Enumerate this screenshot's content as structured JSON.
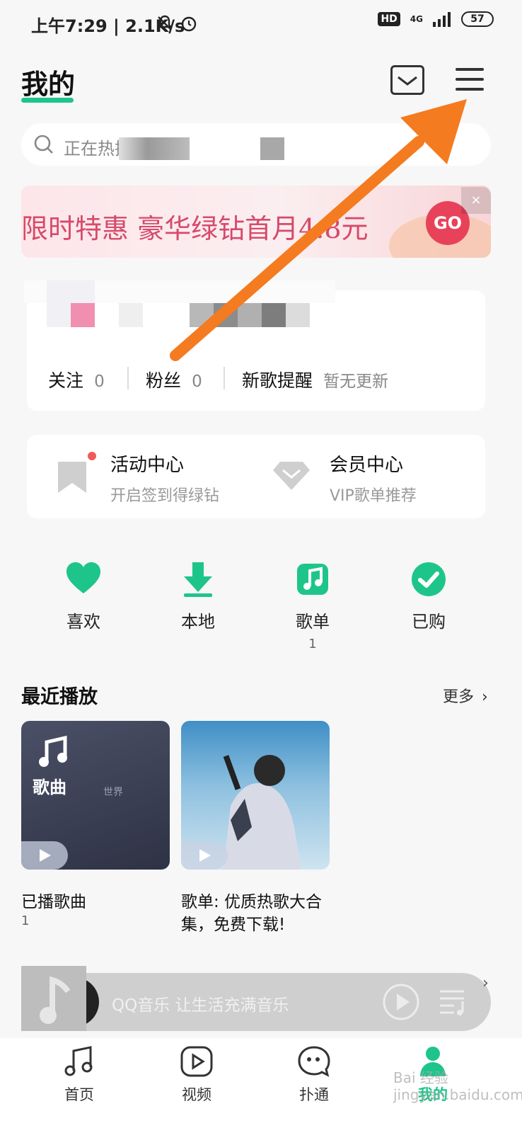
{
  "status_bar": {
    "text": "上午7:29 | 2.1K/s",
    "hd": "HD",
    "network": "4G",
    "battery": "57"
  },
  "header": {
    "title": "我的"
  },
  "search": {
    "placeholder": "正在热搜"
  },
  "promo": {
    "text": "限时特惠 豪华绿钻首月4.8元",
    "go_label": "GO",
    "close_label": "×"
  },
  "profile": {
    "stats": [
      {
        "label": "关注",
        "value": "0"
      },
      {
        "label": "粉丝",
        "value": "0"
      }
    ],
    "new_songs": {
      "label": "新歌提醒",
      "value": "暂无更新"
    }
  },
  "activities": [
    {
      "title": "活动中心",
      "subtitle": "开启签到得绿钻"
    },
    {
      "title": "会员中心",
      "subtitle": "VIP歌单推荐"
    }
  ],
  "quick_actions": [
    {
      "label": "喜欢",
      "count": ""
    },
    {
      "label": "本地",
      "count": ""
    },
    {
      "label": "歌单",
      "count": "1"
    },
    {
      "label": "已购",
      "count": ""
    }
  ],
  "recent": {
    "title": "最近播放",
    "more": "更多",
    "items": [
      {
        "title": "已播歌曲",
        "subtitle": "1",
        "cover_label": "歌曲",
        "cover_text": "世界"
      },
      {
        "title": "歌单: 优质热歌大合集，免费下载!",
        "subtitle": ""
      }
    ]
  },
  "mini_player": {
    "text": "QQ音乐 让生活充满音乐"
  },
  "tabs": [
    {
      "label": "首页"
    },
    {
      "label": "视频"
    },
    {
      "label": "扑通"
    },
    {
      "label": "我的"
    }
  ],
  "watermark": "Bai 经验 jingyan.baidu.com",
  "colors": {
    "accent": "#1ec58a",
    "promo": "#d64a6a",
    "arrow": "#f47b20"
  }
}
